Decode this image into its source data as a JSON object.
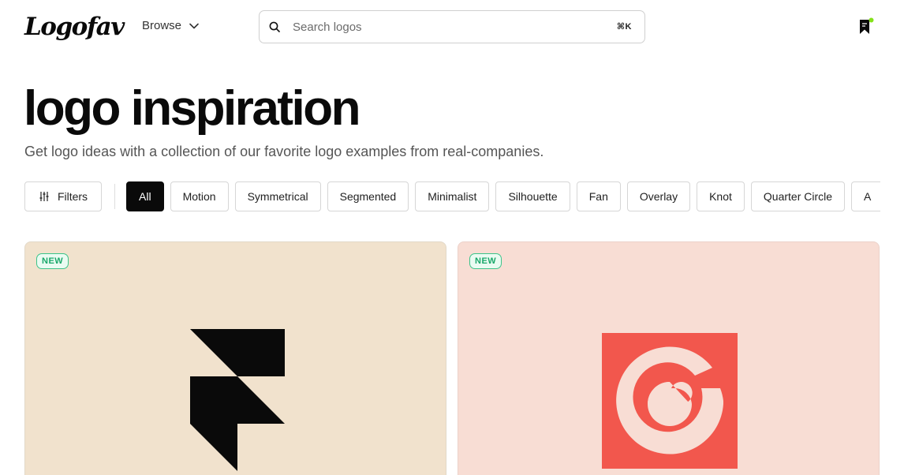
{
  "header": {
    "brand": "Logofav",
    "browse_label": "Browse",
    "search": {
      "placeholder": "Search logos",
      "shortcut": "⌘K"
    },
    "bookmark_icon": "bookmark-icon",
    "bookmark_dot_color": "#84e11a"
  },
  "hero": {
    "title": "logo inspiration",
    "subtitle": "Get logo ideas with a collection of our favorite logo examples from real-companies."
  },
  "filters": {
    "button_label": "Filters",
    "chips": [
      {
        "label": "All",
        "active": true
      },
      {
        "label": "Motion",
        "active": false
      },
      {
        "label": "Symmetrical",
        "active": false
      },
      {
        "label": "Segmented",
        "active": false
      },
      {
        "label": "Minimalist",
        "active": false
      },
      {
        "label": "Silhouette",
        "active": false
      },
      {
        "label": "Fan",
        "active": false
      },
      {
        "label": "Overlay",
        "active": false
      },
      {
        "label": "Knot",
        "active": false
      },
      {
        "label": "Quarter Circle",
        "active": false
      },
      {
        "label": "A",
        "active": false
      }
    ]
  },
  "cards": [
    {
      "badge": "NEW",
      "background": "#f1e2cd",
      "logo_color": "#0a0a0a"
    },
    {
      "badge": "NEW",
      "background": "#f8ddd4",
      "logo_color": "#f2574d"
    }
  ]
}
